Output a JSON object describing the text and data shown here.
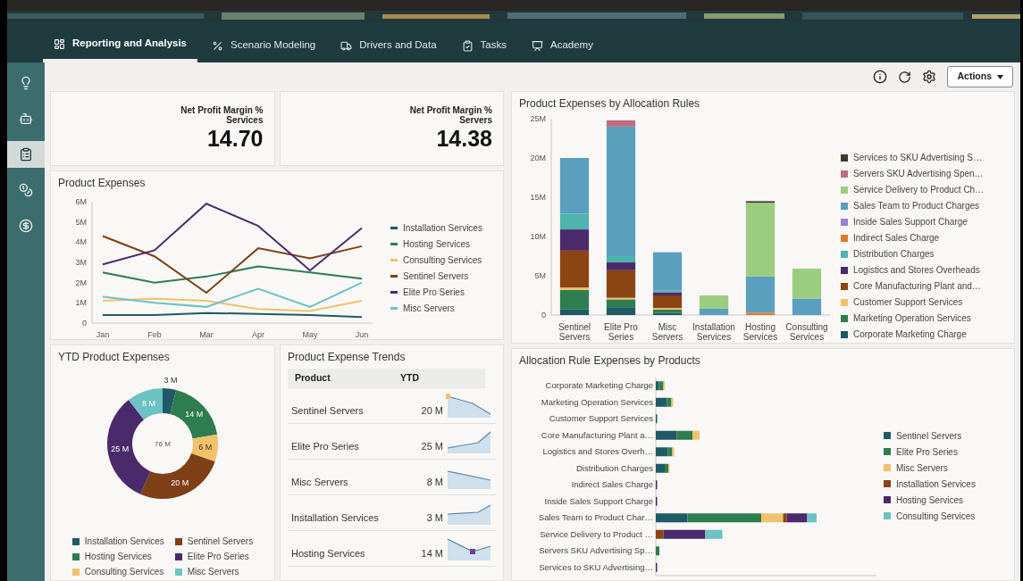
{
  "nav": {
    "tabs": [
      {
        "label": "Reporting and Analysis",
        "selected": true
      },
      {
        "label": "Scenario Modeling",
        "selected": false
      },
      {
        "label": "Drivers and Data",
        "selected": false
      },
      {
        "label": "Tasks",
        "selected": false
      },
      {
        "label": "Academy",
        "selected": false
      }
    ]
  },
  "sidebar": {
    "items": [
      {
        "selected": false
      },
      {
        "selected": false
      },
      {
        "selected": true
      },
      {
        "selected": false
      },
      {
        "selected": false
      }
    ]
  },
  "toolbar": {
    "actions_button": "Actions"
  },
  "kpis": [
    {
      "title": "Net Profit Margin %",
      "subtitle": "Services",
      "value": "14.70"
    },
    {
      "title": "Net Profit Margin %",
      "subtitle": "Servers",
      "value": "14.38"
    }
  ],
  "product_expenses": {
    "chart_data": {
      "type": "line",
      "title": "Product Expenses",
      "legend": true,
      "categories": [
        "Jan",
        "Feb",
        "Mar",
        "Apr",
        "May",
        "Jun"
      ],
      "ylim": [
        0,
        6
      ],
      "yticks": [
        {
          "value": 0,
          "label": "0"
        },
        {
          "value": 1,
          "label": "1M"
        },
        {
          "value": 2,
          "label": "2M"
        },
        {
          "value": 3,
          "label": "3M"
        },
        {
          "value": 4,
          "label": "4M"
        },
        {
          "value": 5,
          "label": "5M"
        },
        {
          "value": 6,
          "label": "6M"
        }
      ],
      "series": [
        {
          "name": "Installation Services",
          "color": "#1f5a66",
          "values": [
            0.4,
            0.4,
            0.5,
            0.45,
            0.4,
            0.3
          ]
        },
        {
          "name": "Hosting Services",
          "color": "#2e7d4f",
          "values": [
            2.5,
            2.0,
            2.3,
            2.8,
            2.5,
            2.2
          ]
        },
        {
          "name": "Consulting Services",
          "color": "#f2c26b",
          "values": [
            1.1,
            1.2,
            1.1,
            0.7,
            0.6,
            1.1
          ]
        },
        {
          "name": "Sentinel Servers",
          "color": "#7f3f17",
          "values": [
            4.3,
            3.3,
            1.5,
            3.7,
            3.2,
            3.8
          ]
        },
        {
          "name": "Elite Pro Series",
          "color": "#4b2a6b",
          "values": [
            2.9,
            3.6,
            5.9,
            4.8,
            2.6,
            4.7
          ]
        },
        {
          "name": "Misc Servers",
          "color": "#6cc2c4",
          "values": [
            1.3,
            1.0,
            0.8,
            1.7,
            0.8,
            2.0
          ]
        }
      ]
    }
  },
  "ytd_product_expenses": {
    "chart_data": {
      "type": "donut",
      "title": "YTD Product Expenses",
      "legend": true,
      "categories": [
        "Installation Services",
        "Hosting Services",
        "Consulting Services",
        "Sentinel Servers",
        "Elite Pro Series",
        "Misc Servers"
      ],
      "values": [
        3,
        14,
        6,
        20,
        25,
        8
      ],
      "colors": [
        "#1f5a66",
        "#2e7d4f",
        "#f2c26b",
        "#7f3f17",
        "#4b2a6b",
        "#6cc2c4"
      ],
      "value_labels": [
        "3 M",
        "14 M",
        "6 M",
        "20 M",
        "25 M",
        "8 M"
      ],
      "annotations": [
        {
          "text": "76 M"
        }
      ]
    }
  },
  "expense_trends": {
    "title": "Product Expense Trends",
    "columns": [
      "Product",
      "YTD"
    ],
    "rows": [
      {
        "product": "Sentinel Servers",
        "ytd": "20 M"
      },
      {
        "product": "Elite Pro Series",
        "ytd": "25 M"
      },
      {
        "product": "Misc Servers",
        "ytd": "8 M"
      },
      {
        "product": "Installation Services",
        "ytd": "3 M"
      },
      {
        "product": "Hosting Services",
        "ytd": "14 M"
      }
    ]
  },
  "allocation_rules": {
    "chart_data": {
      "type": "bar",
      "stacked": true,
      "title": "Product Expenses by Allocation Rules",
      "legend": true,
      "categories": [
        "Sentinel Servers",
        "Elite Pro Series",
        "Misc Servers",
        "Installation Services",
        "Hosting Services",
        "Consulting Services"
      ],
      "ylim": [
        0,
        25
      ],
      "yticks": [
        {
          "value": 0,
          "label": "0"
        },
        {
          "value": 5,
          "label": "5M"
        },
        {
          "value": 10,
          "label": "10M"
        },
        {
          "value": 15,
          "label": "15M"
        },
        {
          "value": 20,
          "label": "20M"
        },
        {
          "value": 25,
          "label": "25M"
        }
      ],
      "series": [
        {
          "name": "Services to SKU Advertising S…",
          "color": "#3b3a2e",
          "values": [
            0,
            0,
            0,
            0,
            0.2,
            0
          ]
        },
        {
          "name": "Servers SKU Advertising Spen…",
          "color": "#c06c84",
          "values": [
            0,
            0.8,
            0,
            0,
            0,
            0
          ]
        },
        {
          "name": "Service Delivery to Product Ch…",
          "color": "#9ccc7f",
          "values": [
            0,
            0,
            0,
            1.7,
            9.4,
            3.8
          ]
        },
        {
          "name": "Sales Team to Product Charges",
          "color": "#5b9fbf",
          "values": [
            7.1,
            16.5,
            4.9,
            0.8,
            4.6,
            2.1
          ]
        },
        {
          "name": "Inside Sales Support Charge",
          "color": "#9b7fd4",
          "values": [
            0,
            0,
            0,
            0,
            0,
            0
          ]
        },
        {
          "name": "Indirect Sales Charge",
          "color": "#e07b28",
          "values": [
            0,
            0,
            0,
            0,
            0.3,
            0
          ]
        },
        {
          "name": "Distribution Charges",
          "color": "#4fb3b0",
          "values": [
            2.0,
            0.8,
            0.2,
            0,
            0,
            0
          ]
        },
        {
          "name": "Logistics and Stores Overheads",
          "color": "#4b2a6b",
          "values": [
            2.7,
            1.0,
            0.4,
            0,
            0,
            0
          ]
        },
        {
          "name": "Core Manufacturing Plant and…",
          "color": "#8b4513",
          "values": [
            4.7,
            3.5,
            1.6,
            0,
            0,
            0
          ]
        },
        {
          "name": "Customer Support Services",
          "color": "#f2c26b",
          "values": [
            0.3,
            0.2,
            0.2,
            0,
            0,
            0
          ]
        },
        {
          "name": "Marketing Operation Services",
          "color": "#2e7d4f",
          "values": [
            2.5,
            1.0,
            0.4,
            0,
            0,
            0
          ]
        },
        {
          "name": "Corporate Marketing Charge",
          "color": "#1f5a66",
          "values": [
            0.7,
            1.0,
            0.3,
            0,
            0,
            0
          ]
        }
      ]
    }
  },
  "allocation_by_products": {
    "title": "Allocation Rule Expenses by Products",
    "categories": [
      "Corporate Marketing Charge",
      "Marketing Operation Services",
      "Customer Support Services",
      "Core Manufacturing Plant a…",
      "Logistics and Stores Overh…",
      "Distribution Charges",
      "Indirect Sales Charge",
      "Inside Sales Support Charge",
      "Sales Team to Product Char…",
      "Service Delivery to Product …",
      "Servers SKU Advertising Sp…",
      "Services to SKU Advertising…"
    ],
    "legend": [
      {
        "name": "Sentinel Servers",
        "color": "#1f5a66"
      },
      {
        "name": "Elite Pro Series",
        "color": "#2e7d4f"
      },
      {
        "name": "Misc Servers",
        "color": "#f2c26b"
      },
      {
        "name": "Installation Services",
        "color": "#8b4513"
      },
      {
        "name": "Hosting Services",
        "color": "#4b2a6b"
      },
      {
        "name": "Consulting Services",
        "color": "#6cc2c4"
      }
    ]
  }
}
